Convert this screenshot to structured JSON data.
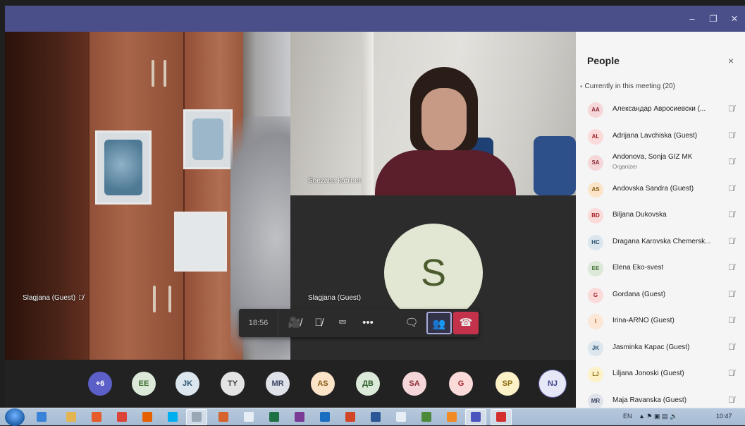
{
  "window": {
    "minimize": "–",
    "maximize": "❐",
    "close": "✕"
  },
  "tiles": {
    "left_name": "Slagjana (Guest)",
    "topright_name": "Snezana kabinet",
    "botright_name": "Slagjana (Guest)",
    "botright_initial": "S"
  },
  "controls": {
    "time": "18:56",
    "video_off": "🎥̸",
    "mute": "🎙̸",
    "share": "⮹",
    "more": "•••",
    "chat": "🗨",
    "people": "👥",
    "hangup": "☎"
  },
  "strip": [
    {
      "label": "+6",
      "bg": "#5b5fc7",
      "fg": "#ffffff"
    },
    {
      "label": "EE",
      "bg": "#dce9d8",
      "fg": "#3b6b30"
    },
    {
      "label": "JK",
      "bg": "#dbe6ee",
      "fg": "#2b5470"
    },
    {
      "label": "TY",
      "bg": "#e4e4e4",
      "fg": "#444444"
    },
    {
      "label": "MR",
      "bg": "#e0e2ea",
      "fg": "#3d4663"
    },
    {
      "label": "AS",
      "bg": "#fbe4c8",
      "fg": "#8a5a16"
    },
    {
      "label": "ДВ",
      "bg": "#dcebd9",
      "fg": "#2f5e2a"
    },
    {
      "label": "SA",
      "bg": "#f6d7d9",
      "fg": "#8c2d34"
    },
    {
      "label": "G",
      "bg": "#fbdada",
      "fg": "#a3262b"
    },
    {
      "label": "SP",
      "bg": "#fdf1c8",
      "fg": "#8a6c10"
    },
    {
      "label": "NJ",
      "bg": "#e7e8f7",
      "fg": "#3f4487"
    }
  ],
  "people_pane": {
    "title": "People",
    "close": "×",
    "section": "Currently in this meeting (20)",
    "people": [
      {
        "initials": "AA",
        "name": "Александар Авросиевски (...",
        "role": "",
        "bg": "#f6d7d9",
        "fg": "#8c2d34"
      },
      {
        "initials": "AL",
        "name": "Adrijana Lavchiska (Guest)",
        "role": "",
        "bg": "#fbdada",
        "fg": "#a3262b"
      },
      {
        "initials": "SA",
        "name": "Andonova, Sonja GIZ MK",
        "role": "Organizer",
        "bg": "#f6d7d9",
        "fg": "#8c2d34"
      },
      {
        "initials": "AS",
        "name": "Andovska Sandra (Guest)",
        "role": "",
        "bg": "#fbe4c8",
        "fg": "#8a5a16"
      },
      {
        "initials": "BD",
        "name": "Biljana Dukovska",
        "role": "",
        "bg": "#fbdada",
        "fg": "#a3262b"
      },
      {
        "initials": "HC",
        "name": "Dragana Karovska Chemersk...",
        "role": "",
        "bg": "#dbe6ee",
        "fg": "#2b5470"
      },
      {
        "initials": "EE",
        "name": "Elena Eko-svest",
        "role": "",
        "bg": "#dce9d8",
        "fg": "#3b6b30"
      },
      {
        "initials": "G",
        "name": "Gordana (Guest)",
        "role": "",
        "bg": "#fbdada",
        "fg": "#a3262b"
      },
      {
        "initials": "I",
        "name": "Irina-ARNO (Guest)",
        "role": "",
        "bg": "#fce6d6",
        "fg": "#b0521a"
      },
      {
        "initials": "JK",
        "name": "Jasminka Kapac (Guest)",
        "role": "",
        "bg": "#dbe6ee",
        "fg": "#2b5470"
      },
      {
        "initials": "LJ",
        "name": "Liljana Jonoski (Guest)",
        "role": "",
        "bg": "#fdf1c8",
        "fg": "#8a6c10"
      },
      {
        "initials": "MR",
        "name": "Maja Ravanska (Guest)",
        "role": "",
        "bg": "#e0e2ea",
        "fg": "#3d4663"
      }
    ]
  },
  "taskbar": {
    "lang": "EN",
    "clock": "10:47"
  },
  "colors": {
    "teams_purple": "#4a4e89",
    "hangup_red": "#c4314b"
  }
}
